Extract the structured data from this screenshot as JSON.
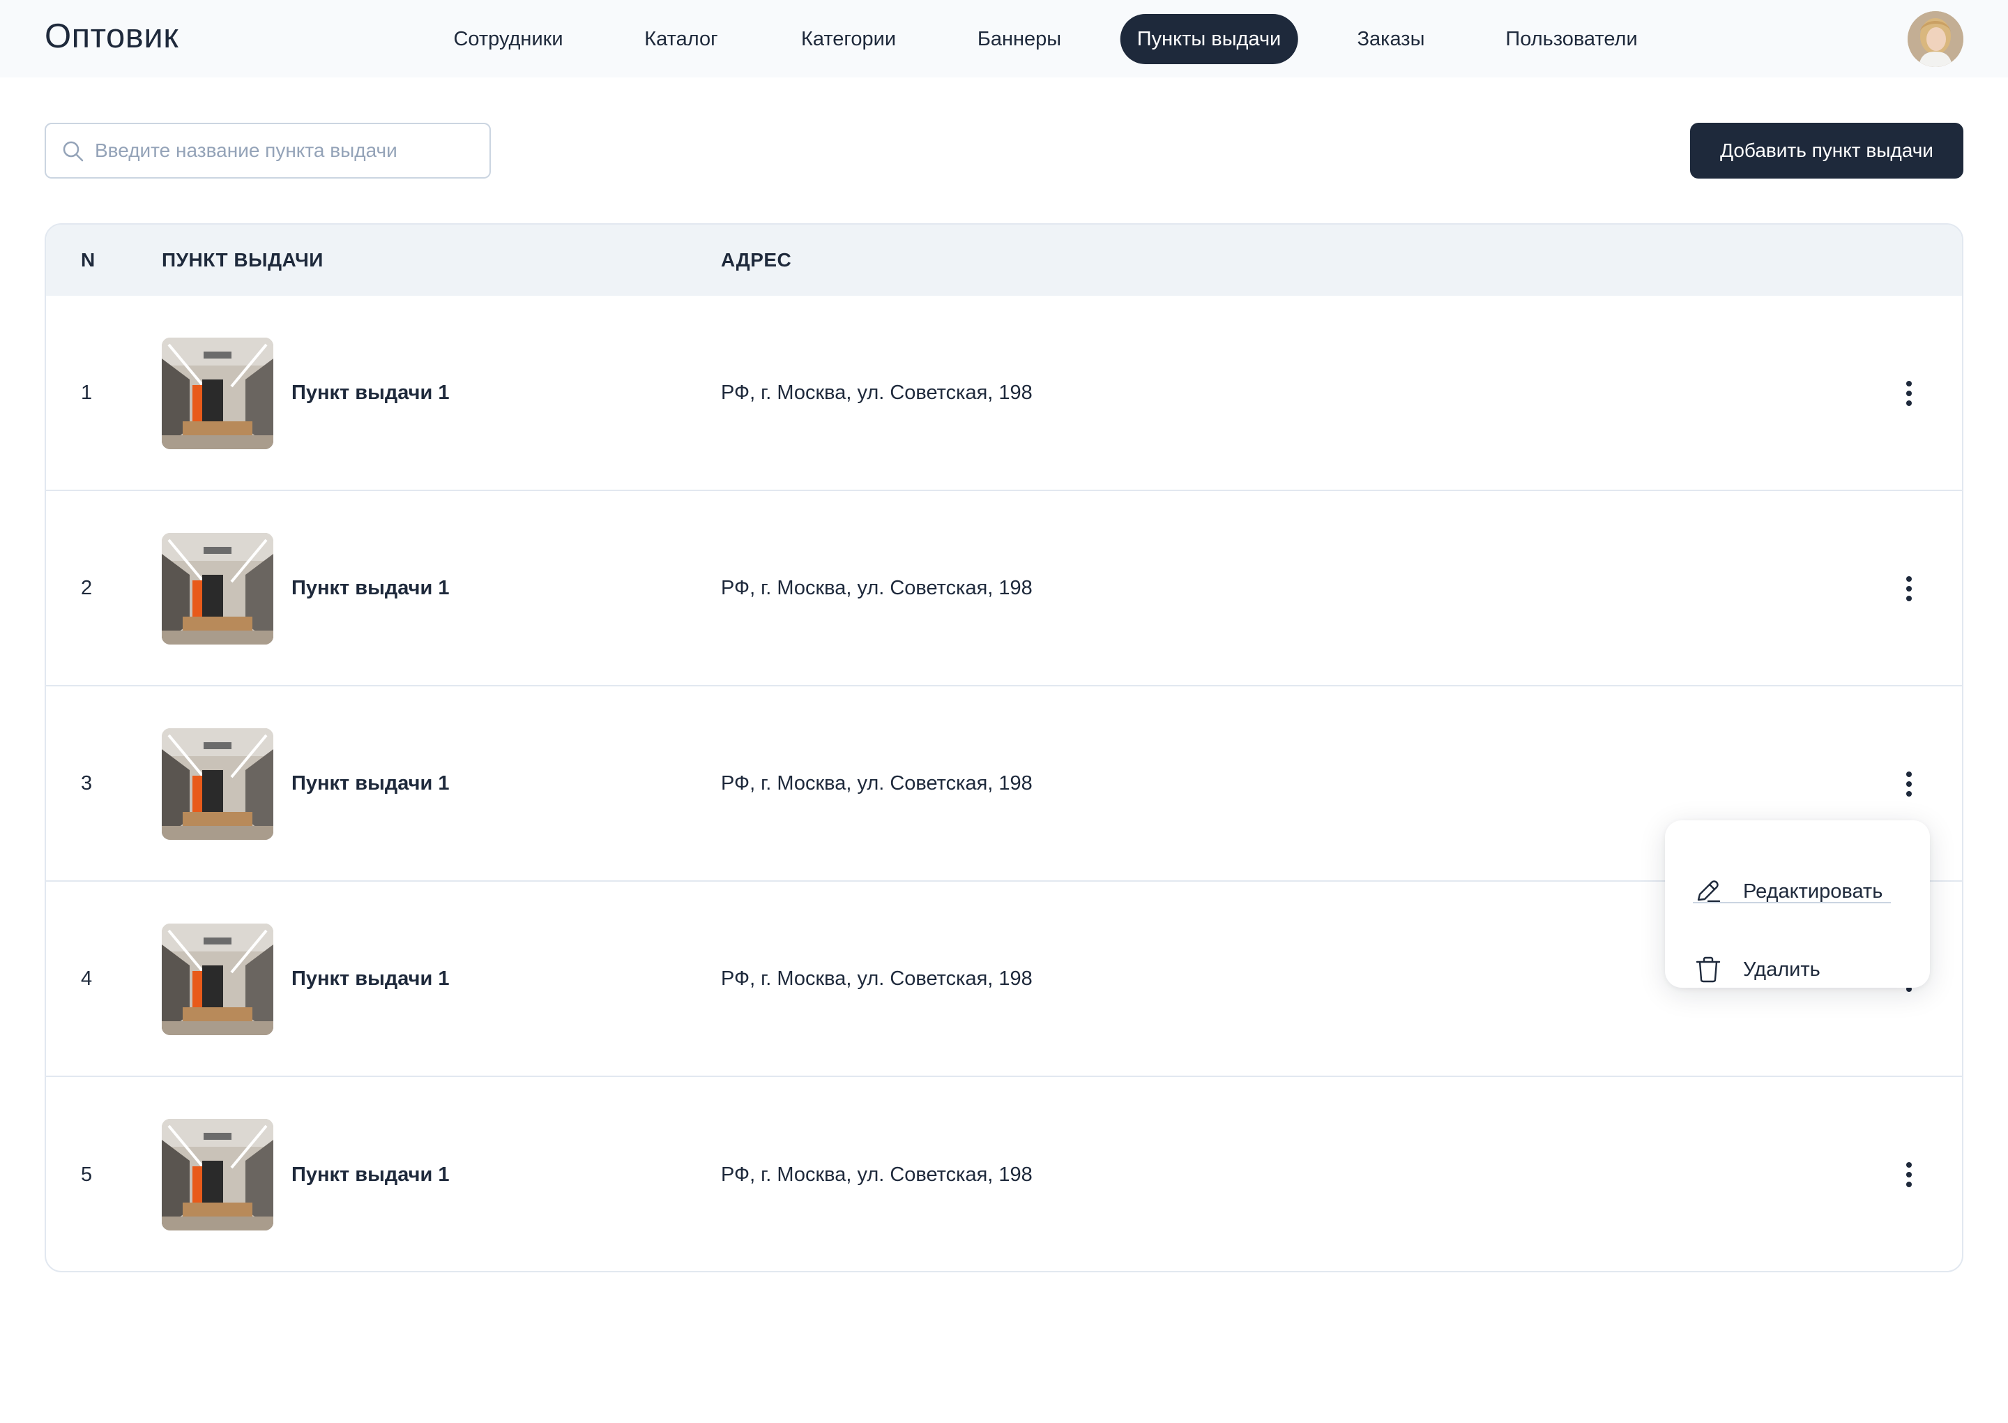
{
  "app": {
    "logo": "Оптовик"
  },
  "nav": {
    "items": [
      {
        "label": "Сотрудники",
        "active": false
      },
      {
        "label": "Каталог",
        "active": false
      },
      {
        "label": "Категории",
        "active": false
      },
      {
        "label": "Баннеры",
        "active": false
      },
      {
        "label": "Пункты выдачи",
        "active": true
      },
      {
        "label": "Заказы",
        "active": false
      },
      {
        "label": "Пользователи",
        "active": false
      }
    ]
  },
  "search": {
    "placeholder": "Введите название пункта выдачи",
    "value": ""
  },
  "actions": {
    "add_label": "Добавить пункт выдачи"
  },
  "table": {
    "columns": [
      "N",
      "ПУНКТ ВЫДАЧИ",
      "АДРЕС"
    ],
    "rows": [
      {
        "n": "1",
        "name": "Пункт выдачи 1",
        "address": "РФ, г. Москва, ул. Советская, 198"
      },
      {
        "n": "2",
        "name": "Пункт выдачи 1",
        "address": "РФ, г. Москва, ул. Советская, 198"
      },
      {
        "n": "3",
        "name": "Пункт выдачи 1",
        "address": "РФ, г. Москва, ул. Советская, 198"
      },
      {
        "n": "4",
        "name": "Пункт выдачи 1",
        "address": "РФ, г. Москва, ул. Советская, 198"
      },
      {
        "n": "5",
        "name": "Пункт выдачи 1",
        "address": "РФ, г. Москва, ул. Советская, 198"
      }
    ]
  },
  "context_menu": {
    "open_for_row": "3",
    "edit_label": "Редактировать",
    "delete_label": "Удалить"
  },
  "icons": {
    "search": "search-icon",
    "more": "more-vertical-icon",
    "edit": "pencil-icon",
    "delete": "trash-icon"
  },
  "colors": {
    "primary": "#1e293b",
    "header_bg": "#f8fafc",
    "table_head_bg": "#eff3f7",
    "border": "#e2e8f0",
    "placeholder": "#94a3b8"
  }
}
